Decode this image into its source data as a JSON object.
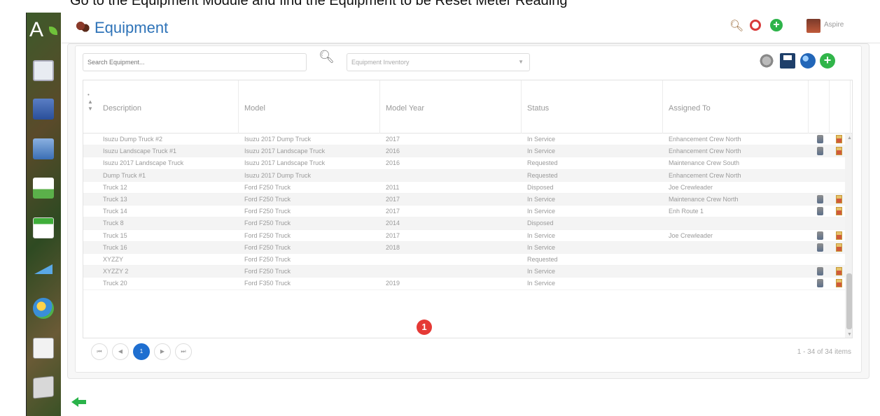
{
  "top_caption": "Go to the Equipment Module and find the Equipment to be Reset Meter Reading",
  "app_logo_letter": "A",
  "page_title": "Equipment",
  "user_name": "Aspire",
  "toolbar": {
    "search_placeholder": "Search Equipment...",
    "inventory_select": "Equipment Inventory"
  },
  "columns": [
    "Description",
    "Model",
    "Model Year",
    "Status",
    "Assigned To"
  ],
  "rows": [
    {
      "description": "Isuzu Dump Truck #2",
      "model": "Isuzu 2017 Dump Truck",
      "year": "2017",
      "status": "In Service",
      "assigned": "Enhancement Crew North",
      "actions": true
    },
    {
      "description": "Isuzu Landscape Truck #1",
      "model": "Isuzu 2017 Landscape Truck",
      "year": "2016",
      "status": "In Service",
      "assigned": "Enhancement Crew North",
      "actions": true
    },
    {
      "description": "Isuzu 2017 Landscape Truck",
      "model": "Isuzu 2017 Landscape Truck",
      "year": "2016",
      "status": "Requested",
      "assigned": "Maintenance Crew South",
      "actions": false
    },
    {
      "description": "Dump Truck #1",
      "model": "Isuzu 2017 Dump Truck",
      "year": "",
      "status": "Requested",
      "assigned": "Enhancement Crew North",
      "actions": false
    },
    {
      "description": "Truck 12",
      "model": "Ford F250 Truck",
      "year": "2011",
      "status": "Disposed",
      "assigned": "Joe Crewleader",
      "actions": false
    },
    {
      "description": "Truck 13",
      "model": "Ford F250 Truck",
      "year": "2017",
      "status": "In Service",
      "assigned": "Maintenance Crew North",
      "actions": true
    },
    {
      "description": "Truck 14",
      "model": "Ford F250 Truck",
      "year": "2017",
      "status": "In Service",
      "assigned": "Enh Route 1",
      "actions": true
    },
    {
      "description": "Truck 8",
      "model": "Ford F250 Truck",
      "year": "2014",
      "status": "Disposed",
      "assigned": "",
      "actions": false
    },
    {
      "description": "Truck 15",
      "model": "Ford F250 Truck",
      "year": "2017",
      "status": "In Service",
      "assigned": "Joe Crewleader",
      "actions": true
    },
    {
      "description": "Truck 16",
      "model": "Ford F250 Truck",
      "year": "2018",
      "status": "In Service",
      "assigned": "",
      "actions": true
    },
    {
      "description": "XYZZY",
      "model": "Ford F250 Truck",
      "year": "",
      "status": "Requested",
      "assigned": "",
      "actions": false
    },
    {
      "description": "XYZZY 2",
      "model": "Ford F250 Truck",
      "year": "",
      "status": "In Service",
      "assigned": "",
      "actions": true
    },
    {
      "description": "Truck 20",
      "model": "Ford F350 Truck",
      "year": "2019",
      "status": "In Service",
      "assigned": "",
      "actions": true
    }
  ],
  "callout_number": "1",
  "pager": {
    "current_page": "1",
    "first": "⏮",
    "prev": "◀",
    "next": "▶",
    "last": "⏭"
  },
  "items_summary": "1 - 34 of 34 items"
}
